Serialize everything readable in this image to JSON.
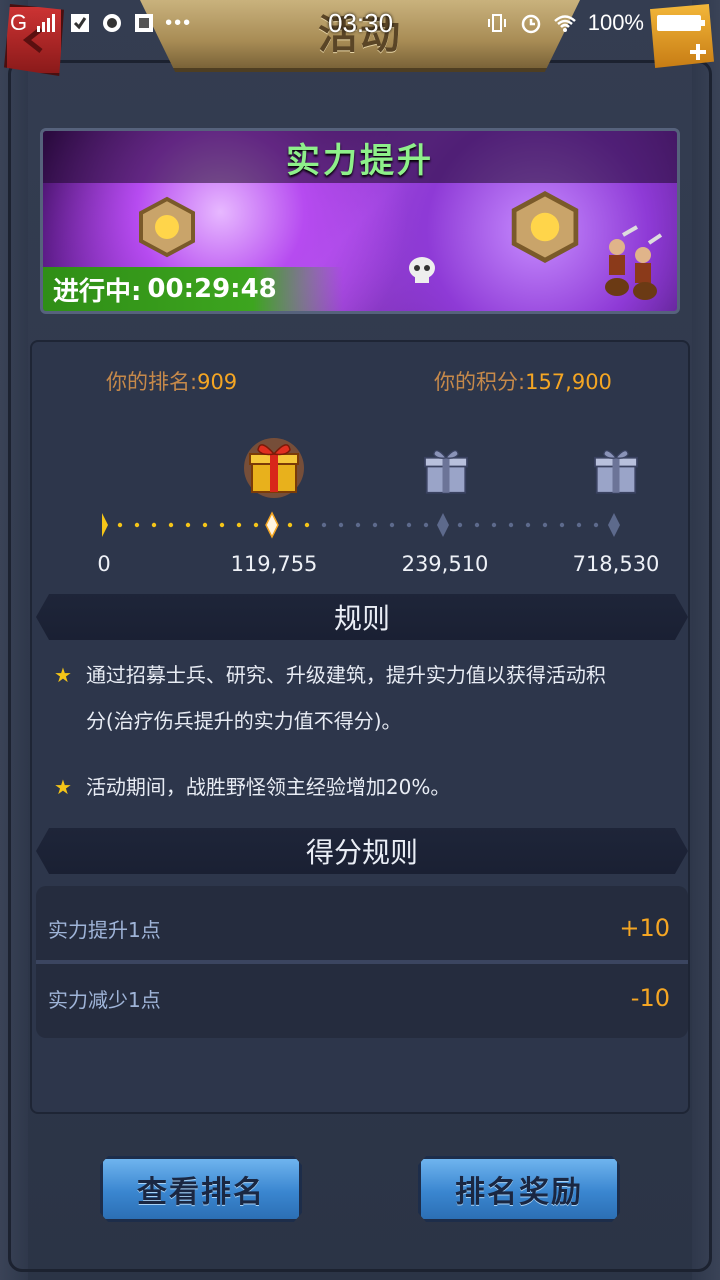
{
  "status_bar": {
    "carrier": "G",
    "time": "03:30",
    "battery": "100%"
  },
  "header": {
    "title": "活动"
  },
  "banner": {
    "title": "实力提升",
    "status_label": "进行中:",
    "countdown": "00:29:48"
  },
  "stats": {
    "rank_label": "你的排名:",
    "rank_value": "909",
    "score_label": "你的积分:",
    "score_value": "157,900"
  },
  "milestones": [
    {
      "label": "0",
      "state": "reached"
    },
    {
      "label": "119,755",
      "state": "current"
    },
    {
      "label": "239,510",
      "state": "locked"
    },
    {
      "label": "718,530",
      "state": "locked"
    }
  ],
  "rewards": [
    {
      "icon": "gold-gift-icon",
      "state": "available"
    },
    {
      "icon": "silver-gift-icon",
      "state": "locked"
    },
    {
      "icon": "silver-gift-icon",
      "state": "locked"
    }
  ],
  "progress_fraction": 0.41,
  "rules_section": {
    "title": "规则",
    "items": [
      {
        "line1": "通过招募士兵、研究、升级建筑，提升实力值以获得活动积",
        "line2": "分(治疗伤兵提升的实力值不得分)。"
      },
      {
        "line1": "活动期间，战胜野怪领主经验增加20%。",
        "line2": ""
      }
    ]
  },
  "scoring_section": {
    "title": "得分规则",
    "rows": [
      {
        "label": "实力提升1点",
        "value": "+10"
      },
      {
        "label": "实力减少1点",
        "value": "-10"
      }
    ]
  },
  "buttons": {
    "view_ranking": "查看排名",
    "ranking_rewards": "排名奖励"
  },
  "colors": {
    "accent_orange": "#f5a623",
    "rank_label": "#c6894a",
    "status_green": "#3da51f",
    "banner_title_green": "#8ef08a",
    "button_blue": "#3a86d0"
  }
}
